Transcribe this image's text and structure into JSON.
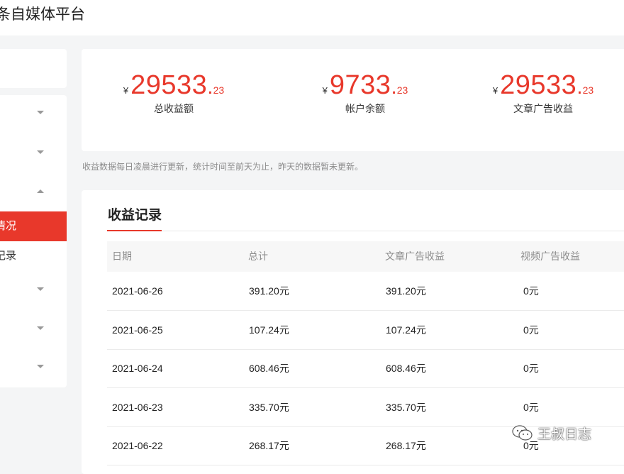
{
  "header": {
    "title": "条自媒体平台"
  },
  "sidebar": {
    "active_item": "情况",
    "second_item": "记录"
  },
  "stats": [
    {
      "currency": "¥",
      "integer": "29533",
      "decimal": "23",
      "label": "总收益额"
    },
    {
      "currency": "¥",
      "integer": "9733",
      "decimal": "23",
      "label": "帐户余额"
    },
    {
      "currency": "¥",
      "integer": "29533",
      "decimal": "23",
      "label": "文章广告收益"
    }
  ],
  "notice": "收益数据每日凌晨进行更新，统计时间至前天为止，昨天的数据暂未更新。",
  "records": {
    "title": "收益记录",
    "columns": [
      "日期",
      "总计",
      "文章广告收益",
      "视频广告收益"
    ],
    "rows": [
      [
        "2021-06-26",
        "391.20元",
        "391.20元",
        "0元"
      ],
      [
        "2021-06-25",
        "107.24元",
        "107.24元",
        "0元"
      ],
      [
        "2021-06-24",
        "608.46元",
        "608.46元",
        "0元"
      ],
      [
        "2021-06-23",
        "335.70元",
        "335.70元",
        "0元"
      ],
      [
        "2021-06-22",
        "268.17元",
        "268.17元",
        "0元"
      ]
    ]
  },
  "watermark": {
    "text": "王叔日志",
    "icon": "wechat-icon"
  },
  "colors": {
    "accent": "#e8382b",
    "muted": "#8c8c8c"
  }
}
